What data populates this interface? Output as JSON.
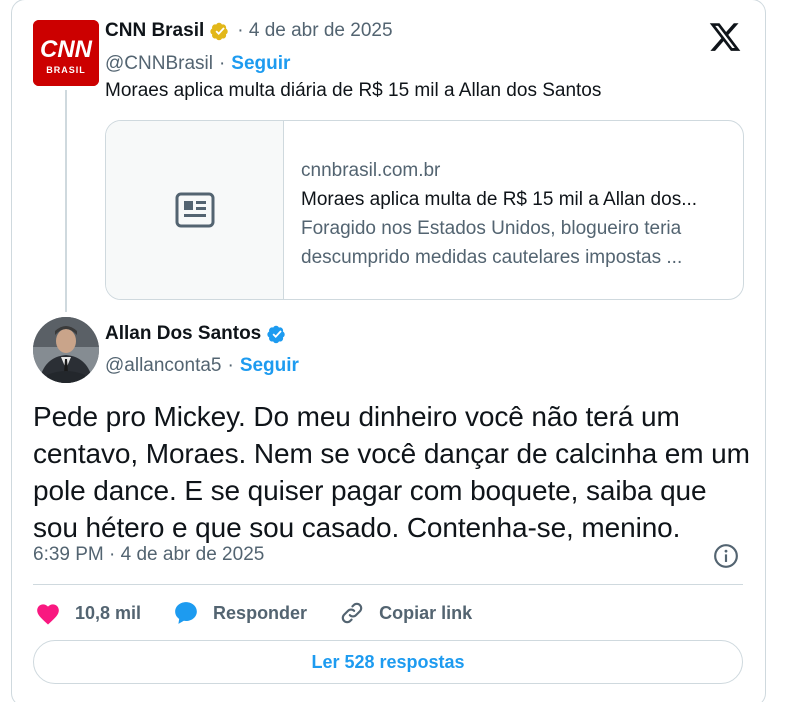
{
  "parent_tweet": {
    "display_name": "CNN Brasil",
    "handle": "@CNNBrasil",
    "date": "· 4 de abr de 2025",
    "follow_label": "Seguir",
    "text": "Moraes aplica multa diária de R$ 15 mil a Allan dos Santos",
    "avatar_logo": "CNN",
    "avatar_sub": "BRASIL",
    "verified": "gold",
    "link_card": {
      "domain": "cnnbrasil.com.br",
      "title": "Moraes aplica multa de R$ 15 mil a Allan dos...",
      "description_line1": "Foragido nos Estados Unidos, blogueiro teria",
      "description_line2": "descumprido medidas cautelares impostas ...",
      "thumb_icon": "news-icon"
    }
  },
  "main_tweet": {
    "display_name": "Allan Dos Santos",
    "handle": "@allanconta5",
    "follow_label": "Seguir",
    "verified": "blue",
    "text": "Pede pro Mickey. Do meu dinheiro você não terá um centavo, Moraes. Nem se você dançar de calcinha em um pole dance. E se quiser pagar com boquete, saiba que sou hétero e que sou casado. Contenha-se, menino.",
    "timestamp": "6:39 PM · 4 de abr de 2025",
    "likes": "10,8 mil",
    "reply_label": "Responder",
    "copy_link_label": "Copiar link",
    "read_replies_label": "Ler 528 respostas"
  },
  "colors": {
    "accent": "#1d9bf0",
    "like": "#f91880",
    "gold_badge": "#e2b719",
    "cnn_red": "#cc0000",
    "border": "#cfd9de"
  },
  "icons": [
    "x-logo-icon",
    "gold-verified-icon",
    "blue-verified-icon",
    "news-icon",
    "info-icon",
    "heart-icon",
    "reply-bubble-icon",
    "link-icon"
  ]
}
